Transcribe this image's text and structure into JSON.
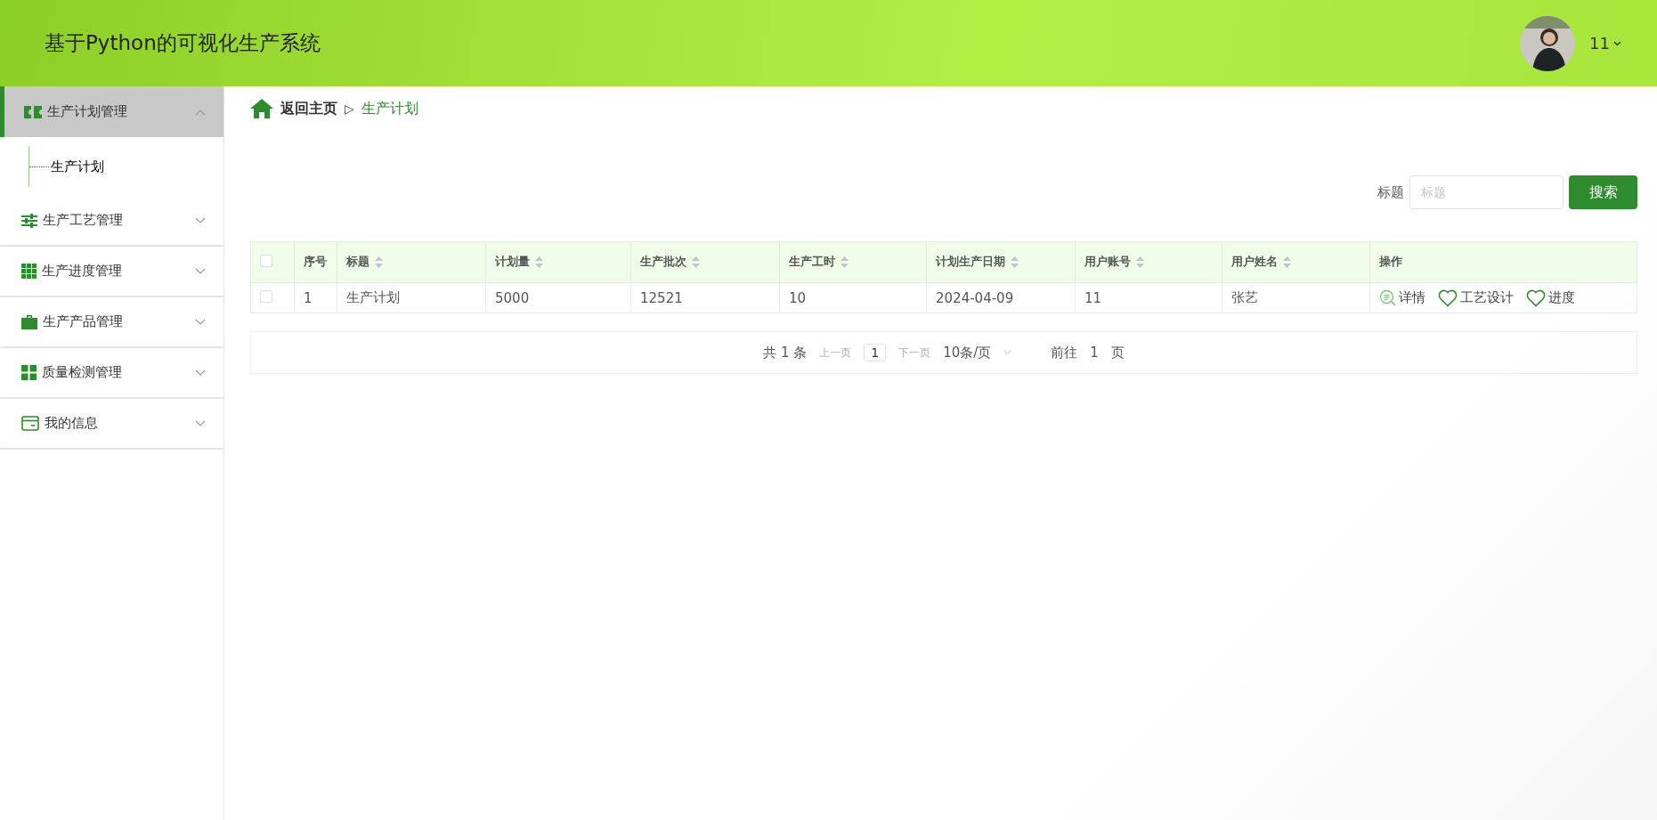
{
  "header": {
    "title": "基于Python的可视化生产系统",
    "user": "11"
  },
  "sidebar": {
    "items": [
      {
        "label": "生产计划管理",
        "kind": "ticket",
        "selected": true,
        "expanded": true,
        "children": [
          {
            "label": "生产计划",
            "selected": true
          }
        ]
      },
      {
        "label": "生产工艺管理",
        "kind": "sliders",
        "selected": false,
        "expanded": false
      },
      {
        "label": "生产进度管理",
        "kind": "grid9",
        "selected": false,
        "expanded": false
      },
      {
        "label": "生产产品管理",
        "kind": "briefcase",
        "selected": false,
        "expanded": false
      },
      {
        "label": "质量检测管理",
        "kind": "grid4",
        "selected": false,
        "expanded": false
      },
      {
        "label": "我的信息",
        "kind": "card",
        "selected": false,
        "expanded": false
      }
    ]
  },
  "breadcrumb": {
    "home": "返回主页",
    "separator": "▷",
    "current": "生产计划"
  },
  "search": {
    "label": "标题",
    "placeholder": "标题",
    "button": "搜索"
  },
  "table": {
    "all_checked": false,
    "columns": [
      {
        "label": "序号",
        "sortable": false
      },
      {
        "label": "标题",
        "sortable": true
      },
      {
        "label": "计划量",
        "sortable": true
      },
      {
        "label": "生产批次",
        "sortable": true
      },
      {
        "label": "生产工时",
        "sortable": true
      },
      {
        "label": "计划生产日期",
        "sortable": true
      },
      {
        "label": "用户账号",
        "sortable": true
      },
      {
        "label": "用户姓名",
        "sortable": true
      },
      {
        "label": "操作",
        "sortable": false
      }
    ],
    "rows": [
      {
        "checked": false,
        "cells": [
          "1",
          "生产计划",
          "5000",
          "12521",
          "10",
          "2024-04-09",
          "11",
          "张艺"
        ],
        "actions": [
          {
            "label": "详情",
            "kind": "detail"
          },
          {
            "label": "工艺设计",
            "kind": "heart"
          },
          {
            "label": "进度",
            "kind": "heart"
          }
        ]
      }
    ]
  },
  "pagination": {
    "total": "共 1 条",
    "prev": "上一页",
    "page": "1",
    "next": "下一页",
    "page_size": "10条/页",
    "goto": "前往",
    "goto_value": "1",
    "goto_suffix": "页"
  }
}
